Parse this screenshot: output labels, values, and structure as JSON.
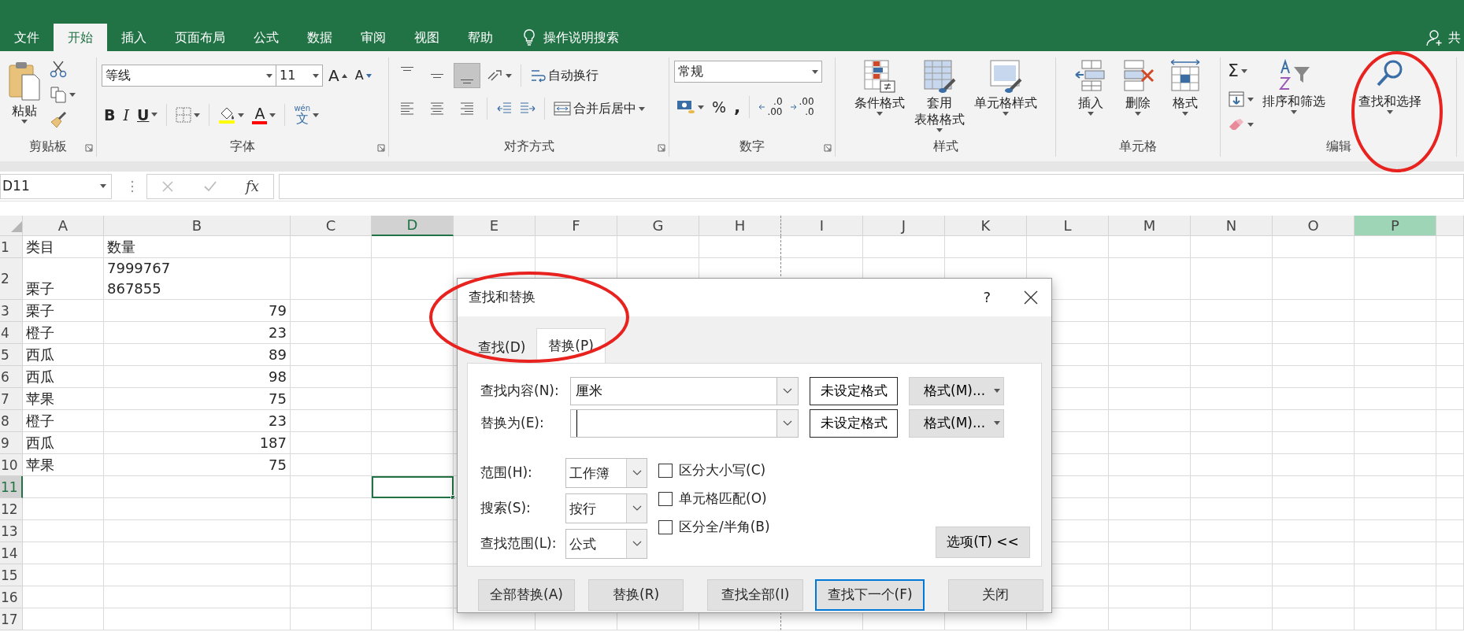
{
  "ribbon_tabs": [
    {
      "label": "文件",
      "selected": false
    },
    {
      "label": "开始",
      "selected": true
    },
    {
      "label": "插入",
      "selected": false
    },
    {
      "label": "页面布局",
      "selected": false
    },
    {
      "label": "公式",
      "selected": false
    },
    {
      "label": "数据",
      "selected": false
    },
    {
      "label": "审阅",
      "selected": false
    },
    {
      "label": "视图",
      "selected": false
    },
    {
      "label": "帮助",
      "selected": false
    }
  ],
  "tell_me": "操作说明搜索",
  "share": "共",
  "ribbon": {
    "clipboard": {
      "label": "剪贴板",
      "paste": "粘贴"
    },
    "font": {
      "label": "字体",
      "font_name": "等线",
      "font_size": "11",
      "grow": "A",
      "shrink": "A",
      "bold": "B",
      "italic": "I",
      "underline": "U",
      "font_color": "A",
      "phonetic": [
        "wén",
        "文"
      ]
    },
    "alignment": {
      "label": "对齐方式",
      "vertical_align": [
        {
          "selected": false
        },
        {
          "selected": false
        },
        {
          "selected": true
        }
      ],
      "wrap_text": "自动换行",
      "merge": "合并后居中"
    },
    "number": {
      "label": "数字",
      "format": "常规",
      "percent": "%",
      "comma": ",",
      "decimal_increase": [
        ".0",
        ".00"
      ],
      "decimal_decrease": [
        ".00",
        ".0"
      ]
    },
    "styles": {
      "label": "样式",
      "buttons": [
        {
          "lines": [
            "条件格式"
          ]
        },
        {
          "lines": [
            "套用",
            "表格格式"
          ]
        },
        {
          "lines": [
            "单元格样式"
          ]
        }
      ]
    },
    "cells": {
      "label": "单元格",
      "buttons": [
        {
          "lines": [
            "插入"
          ]
        },
        {
          "lines": [
            "删除"
          ]
        },
        {
          "lines": [
            "格式"
          ]
        }
      ]
    },
    "editing": {
      "label": "编辑",
      "autosum": "Σ",
      "buttons": [
        {
          "lines": [
            "排序和筛选"
          ]
        },
        {
          "lines": [
            "查找和选择"
          ]
        }
      ]
    }
  },
  "formula_bar": {
    "name_box": "D11",
    "fx": "fx"
  },
  "sheet": {
    "columns": [
      {
        "label": "A",
        "selected": false,
        "highlighted": false,
        "page_break": false
      },
      {
        "label": "B",
        "selected": false,
        "highlighted": false,
        "page_break": false
      },
      {
        "label": "C",
        "selected": false,
        "highlighted": false,
        "page_break": false
      },
      {
        "label": "D",
        "selected": true,
        "highlighted": false,
        "page_break": false
      },
      {
        "label": "E",
        "selected": false,
        "highlighted": false,
        "page_break": false
      },
      {
        "label": "F",
        "selected": false,
        "highlighted": false,
        "page_break": false
      },
      {
        "label": "G",
        "selected": false,
        "highlighted": false,
        "page_break": false
      },
      {
        "label": "H",
        "selected": false,
        "highlighted": false,
        "page_break": true
      },
      {
        "label": "I",
        "selected": false,
        "highlighted": false,
        "page_break": false
      },
      {
        "label": "J",
        "selected": false,
        "highlighted": false,
        "page_break": false
      },
      {
        "label": "K",
        "selected": false,
        "highlighted": false,
        "page_break": false
      },
      {
        "label": "L",
        "selected": false,
        "highlighted": false,
        "page_break": false
      },
      {
        "label": "M",
        "selected": false,
        "highlighted": false,
        "page_break": false
      },
      {
        "label": "N",
        "selected": false,
        "highlighted": false,
        "page_break": false
      },
      {
        "label": "O",
        "selected": false,
        "highlighted": false,
        "page_break": false
      },
      {
        "label": "P",
        "selected": false,
        "highlighted": true,
        "page_break": false
      }
    ],
    "rows": [
      {
        "header": "1",
        "selected": false,
        "cells": [
          {
            "kind": "text",
            "lines": [
              "类目"
            ]
          },
          {
            "kind": "text",
            "lines": [
              "数量"
            ]
          }
        ]
      },
      {
        "header": "2",
        "selected": false,
        "cells": [
          {
            "kind": "text",
            "lines": [
              "栗子"
            ]
          },
          {
            "kind": "text",
            "lines": [
              "7999767",
              "867855"
            ]
          }
        ]
      },
      {
        "header": "3",
        "selected": false,
        "cells": [
          {
            "kind": "text",
            "lines": [
              "栗子"
            ]
          },
          {
            "kind": "number",
            "lines": [
              "79"
            ]
          }
        ]
      },
      {
        "header": "4",
        "selected": false,
        "cells": [
          {
            "kind": "text",
            "lines": [
              "橙子"
            ]
          },
          {
            "kind": "number",
            "lines": [
              "23"
            ]
          }
        ]
      },
      {
        "header": "5",
        "selected": false,
        "cells": [
          {
            "kind": "text",
            "lines": [
              "西瓜"
            ]
          },
          {
            "kind": "number",
            "lines": [
              "89"
            ]
          }
        ]
      },
      {
        "header": "6",
        "selected": false,
        "cells": [
          {
            "kind": "text",
            "lines": [
              "西瓜"
            ]
          },
          {
            "kind": "number",
            "lines": [
              "98"
            ]
          }
        ]
      },
      {
        "header": "7",
        "selected": false,
        "cells": [
          {
            "kind": "text",
            "lines": [
              "苹果"
            ]
          },
          {
            "kind": "number",
            "lines": [
              "75"
            ]
          }
        ]
      },
      {
        "header": "8",
        "selected": false,
        "cells": [
          {
            "kind": "text",
            "lines": [
              "橙子"
            ]
          },
          {
            "kind": "number",
            "lines": [
              "23"
            ]
          }
        ]
      },
      {
        "header": "9",
        "selected": false,
        "cells": [
          {
            "kind": "text",
            "lines": [
              "西瓜"
            ]
          },
          {
            "kind": "number",
            "lines": [
              "187"
            ]
          }
        ]
      },
      {
        "header": "10",
        "selected": false,
        "cells": [
          {
            "kind": "text",
            "lines": [
              "苹果"
            ]
          },
          {
            "kind": "number",
            "lines": [
              "75"
            ]
          }
        ]
      },
      {
        "header": "11",
        "selected": true
      },
      {
        "header": "12",
        "selected": false
      },
      {
        "header": "13",
        "selected": false
      },
      {
        "header": "14",
        "selected": false
      },
      {
        "header": "15",
        "selected": false
      },
      {
        "header": "16",
        "selected": false
      },
      {
        "header": "17",
        "selected": false
      }
    ]
  },
  "dialog": {
    "title": "查找和替换",
    "help": "?",
    "tabs": [
      {
        "label": "查找(D)",
        "selected": false
      },
      {
        "label": "替换(P)",
        "selected": true
      }
    ],
    "fields": [
      {
        "label": "查找内容(N):",
        "value": "厘米",
        "focused": false,
        "format_status": "未设定格式",
        "format_button": "格式(M)..."
      },
      {
        "label": "替换为(E):",
        "focused": true,
        "format_status": "未设定格式",
        "format_button": "格式(M)..."
      }
    ],
    "dropdowns": [
      {
        "label": "范围(H):",
        "value": "工作簿"
      },
      {
        "label": "搜索(S):",
        "value": "按行"
      },
      {
        "label": "查找范围(L):",
        "value": "公式"
      }
    ],
    "checkboxes": [
      {
        "label": "区分大小写(C)",
        "checked": false
      },
      {
        "label": "单元格匹配(O)",
        "checked": false
      },
      {
        "label": "区分全/半角(B)",
        "checked": false
      }
    ],
    "options_button": "选项(T) <<",
    "buttons": [
      {
        "label": "全部替换(A)",
        "default": false
      },
      {
        "label": "替换(R)",
        "default": false
      },
      {
        "label": "查找全部(I)",
        "default": false
      },
      {
        "label": "查找下一个(F)",
        "default": true
      },
      {
        "label": "关闭",
        "default": false
      }
    ]
  },
  "annotation_marks": [
    {
      "kind": "ellipse"
    },
    {
      "kind": "ellipse"
    }
  ]
}
